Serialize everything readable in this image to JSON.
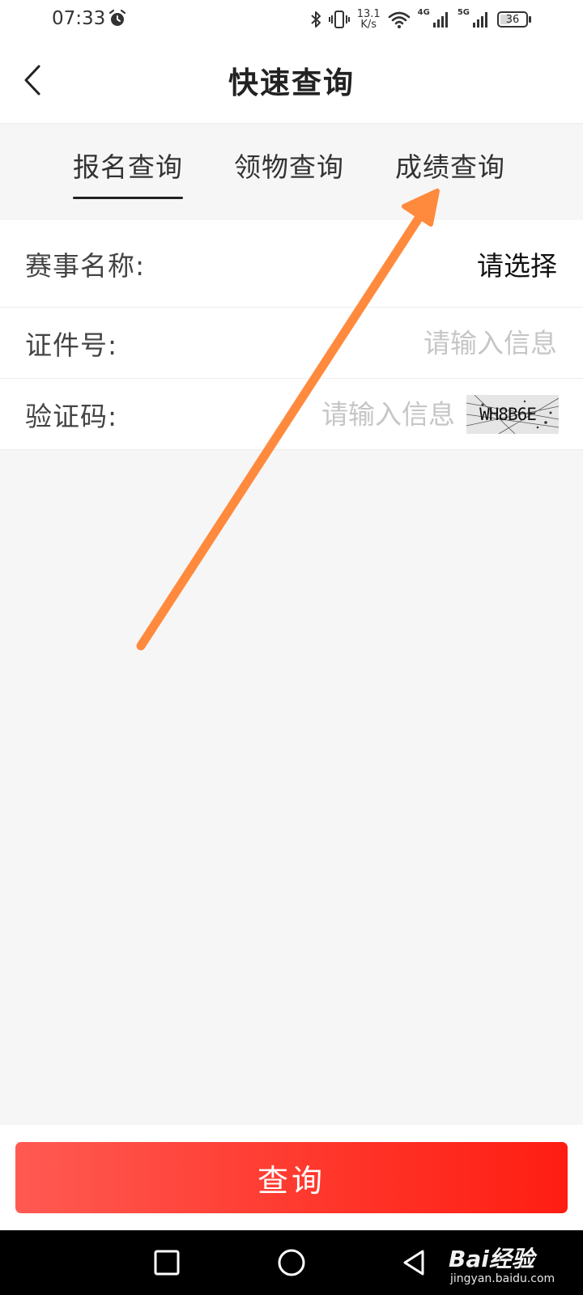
{
  "status_bar": {
    "time": "07:33",
    "speed_value": "13.1",
    "speed_unit": "K/s",
    "net_label_1": "4G",
    "net_label_2": "5G",
    "battery": "36"
  },
  "header": {
    "title": "快速查询"
  },
  "tabs": [
    {
      "label": "报名查询",
      "active": true
    },
    {
      "label": "领物查询",
      "active": false
    },
    {
      "label": "成绩查询",
      "active": false
    }
  ],
  "form": {
    "event_name": {
      "label": "赛事名称:",
      "value": "请选择"
    },
    "id_number": {
      "label": "证件号:",
      "placeholder": "请输入信息"
    },
    "captcha": {
      "label": "验证码:",
      "placeholder": "请输入信息",
      "code": "WH8B6E"
    }
  },
  "query_button": {
    "label": "查询"
  },
  "watermark": {
    "logo": "Bai经验",
    "site": "jingyan.baidu.com"
  },
  "colors": {
    "button_start": "#ff5a52",
    "button_end": "#ff1d12",
    "arrow": "#ff8a3d",
    "page_bg": "#f6f6f6"
  }
}
